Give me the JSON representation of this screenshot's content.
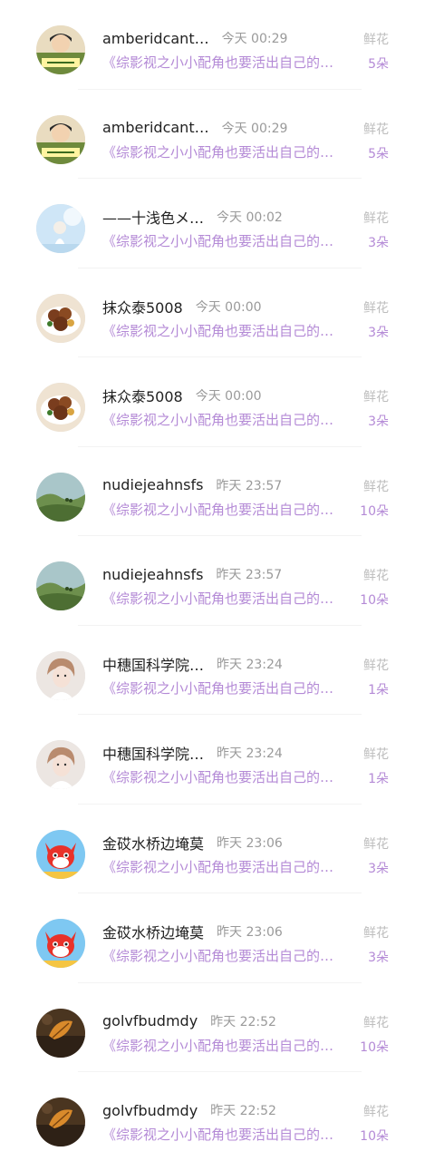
{
  "gift_label": "鲜花",
  "gifts": [
    {
      "name": "amberidcant…",
      "time": "今天 00:29",
      "book": "《综影视之小小配角也要活出自己的…",
      "count": "5朵",
      "avatar": "comic-avatar"
    },
    {
      "name": "amberidcant…",
      "time": "今天 00:29",
      "book": "《综影视之小小配角也要活出自己的…",
      "count": "5朵",
      "avatar": "comic-avatar"
    },
    {
      "name": "——十浅色メ…",
      "time": "今天 00:02",
      "book": "《综影视之小小配角也要活出自己的…",
      "count": "3朵",
      "avatar": "girl-sky-avatar"
    },
    {
      "name": "抹众泰5008",
      "time": "今天 00:00",
      "book": "《综影视之小小配角也要活出自己的…",
      "count": "3朵",
      "avatar": "food-bowl-avatar"
    },
    {
      "name": "抹众泰5008",
      "time": "今天 00:00",
      "book": "《综影视之小小配角也要活出自己的…",
      "count": "3朵",
      "avatar": "food-bowl-avatar"
    },
    {
      "name": "nudiejeahnsfs",
      "time": "昨天 23:57",
      "book": "《综影视之小小配角也要活出自己的…",
      "count": "10朵",
      "avatar": "green-hills-avatar"
    },
    {
      "name": "nudiejeahnsfs",
      "time": "昨天 23:57",
      "book": "《综影视之小小配角也要活出自己的…",
      "count": "10朵",
      "avatar": "green-hills-avatar"
    },
    {
      "name": "中穗国科学院…",
      "time": "昨天 23:24",
      "book": "《综影视之小小配角也要活出自己的…",
      "count": "1朵",
      "avatar": "portrait-avatar"
    },
    {
      "name": "中穗国科学院…",
      "time": "昨天 23:24",
      "book": "《综影视之小小配角也要活出自己的…",
      "count": "1朵",
      "avatar": "portrait-avatar"
    },
    {
      "name": "金砹水桥边埯莫",
      "time": "昨天 23:06",
      "book": "《综影视之小小配角也要活出自己的…",
      "count": "3朵",
      "avatar": "fox-cartoon-avatar"
    },
    {
      "name": "金砹水桥边埯莫",
      "time": "昨天 23:06",
      "book": "《综影视之小小配角也要活出自己的…",
      "count": "3朵",
      "avatar": "fox-cartoon-avatar"
    },
    {
      "name": "golvfbudmdy",
      "time": "昨天 22:52",
      "book": "《综影视之小小配角也要活出自己的…",
      "count": "10朵",
      "avatar": "autumn-leaf-avatar"
    },
    {
      "name": "golvfbudmdy",
      "time": "昨天 22:52",
      "book": "《综影视之小小配角也要活出自己的…",
      "count": "10朵",
      "avatar": "autumn-leaf-avatar"
    }
  ]
}
